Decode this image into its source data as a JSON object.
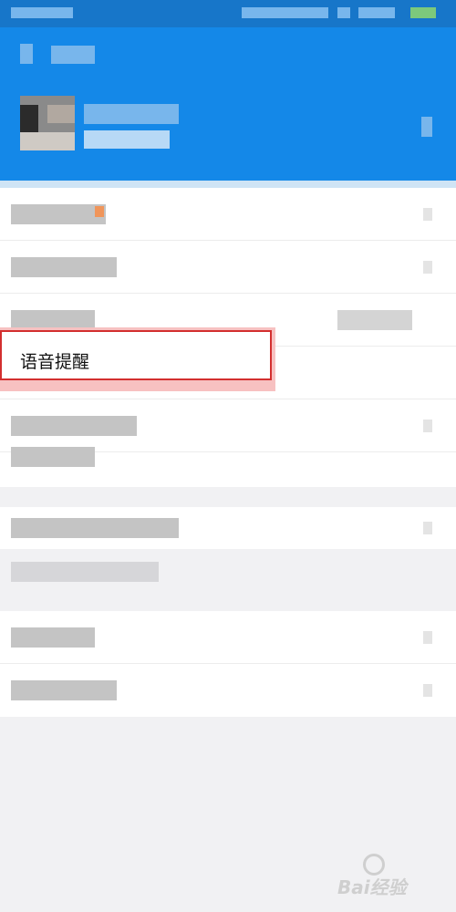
{
  "highlighted_item": {
    "label": "语音提醒"
  },
  "watermark": {
    "text": "Bai经验"
  },
  "colors": {
    "header_blue": "#1488e8",
    "highlight_border": "#d32f2f"
  }
}
